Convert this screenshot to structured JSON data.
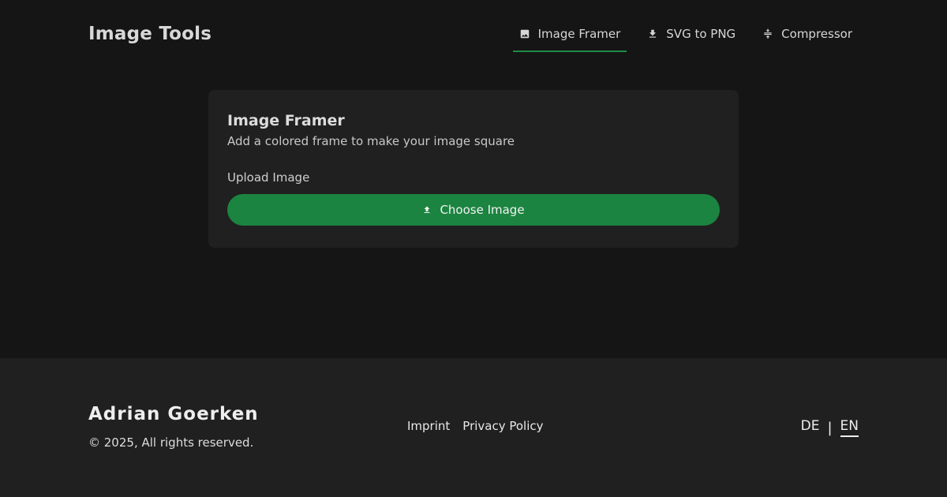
{
  "header": {
    "brand": "Image Tools",
    "tabs": [
      {
        "label": "Image Framer",
        "icon": "image-icon",
        "active": true
      },
      {
        "label": "SVG to PNG",
        "icon": "download-icon",
        "active": false
      },
      {
        "label": "Compressor",
        "icon": "compress-icon",
        "active": false
      }
    ]
  },
  "card": {
    "title": "Image Framer",
    "description": "Add a colored frame to make your image square",
    "upload_label": "Upload Image",
    "button_label": "Choose Image",
    "button_icon": "upload-icon"
  },
  "footer": {
    "name": "Adrian Goerken",
    "copyright": "© 2025, All rights reserved.",
    "links": [
      "Imprint",
      "Privacy Policy"
    ],
    "languages": [
      {
        "code": "DE",
        "active": false
      },
      {
        "code": "EN",
        "active": true
      }
    ],
    "separator": "|"
  },
  "colors": {
    "background": "#151515",
    "surface": "#202020",
    "accent": "#1b8440",
    "active_tab_underline": "#1f8a45"
  }
}
